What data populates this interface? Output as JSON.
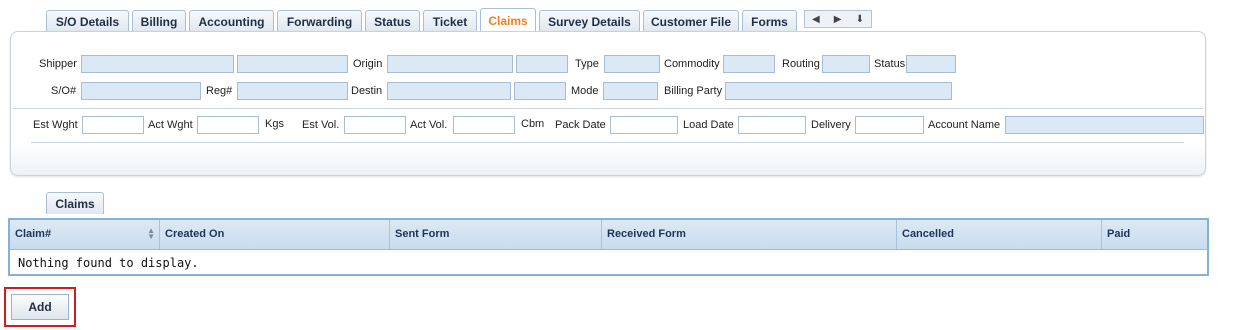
{
  "tabs": [
    {
      "label": "S/O Details",
      "active": false
    },
    {
      "label": "Billing",
      "active": false
    },
    {
      "label": "Accounting",
      "active": false
    },
    {
      "label": "Forwarding",
      "active": false
    },
    {
      "label": "Status",
      "active": false
    },
    {
      "label": "Ticket",
      "active": false
    },
    {
      "label": "Claims",
      "active": true
    },
    {
      "label": "Survey Details",
      "active": false
    },
    {
      "label": "Customer File",
      "active": false
    },
    {
      "label": "Forms",
      "active": false
    }
  ],
  "tab_nav": {
    "left": "◀",
    "right": "▶",
    "down": "⬇"
  },
  "details": {
    "shipper_label": "Shipper",
    "origin_label": "Origin",
    "type_label": "Type",
    "commodity_label": "Commodity",
    "routing_label": "Routing",
    "status_label": "Status",
    "so_label": "S/O#",
    "reg_label": "Reg#",
    "destin_label": "Destin",
    "mode_label": "Mode",
    "billing_party_label": "Billing Party",
    "est_wght_label": "Est Wght",
    "act_wght_label": "Act Wght",
    "kgs_label": "Kgs",
    "est_vol_label": "Est Vol.",
    "act_vol_label": "Act Vol.",
    "cbm_label": "Cbm",
    "pack_date_label": "Pack Date",
    "load_date_label": "Load Date",
    "delivery_label": "Delivery",
    "account_name_label": "Account Name"
  },
  "claims_tab": {
    "label": "Claims"
  },
  "table": {
    "columns": [
      "Claim#",
      "Created On",
      "Sent Form",
      "Received Form",
      "Cancelled",
      "Paid"
    ],
    "empty_message": "Nothing found to display."
  },
  "add_button": {
    "label": "Add"
  }
}
